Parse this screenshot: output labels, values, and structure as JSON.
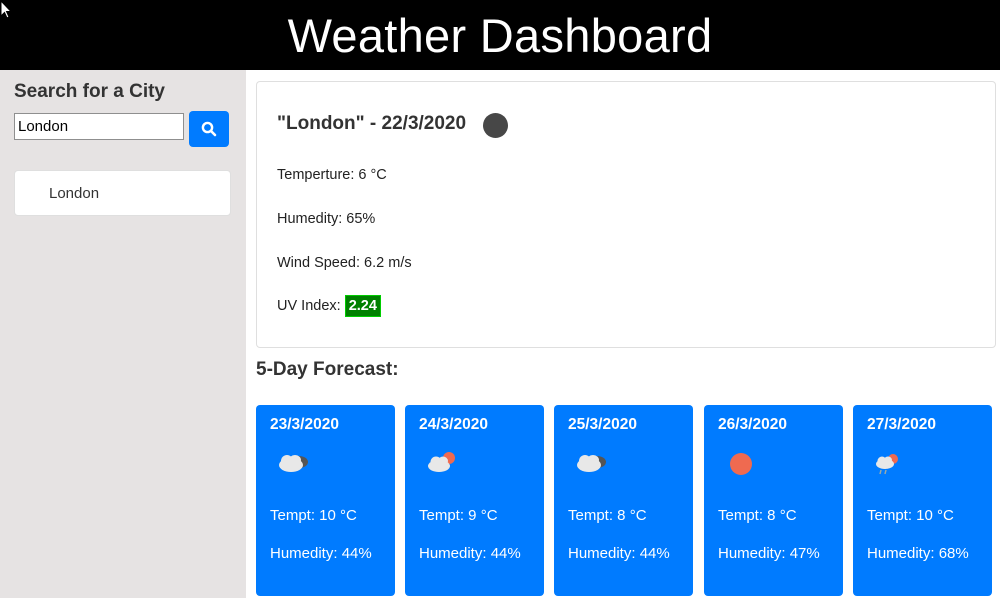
{
  "header": {
    "title": "Weather Dashboard"
  },
  "sidebar": {
    "heading": "Search for a City",
    "search": {
      "value": "London",
      "button_icon": "search-icon"
    },
    "history": [
      "London"
    ]
  },
  "current": {
    "title": "\"London\" - 22/3/2020",
    "icon": "dark-circle-icon",
    "temperature": "Temperture: 6 °C",
    "humidity": "Humedity: 65%",
    "wind": "Wind Speed: 6.2 m/s",
    "uv_label": "UV Index:",
    "uv_value": "2.24",
    "uv_color": "#008000"
  },
  "forecast": {
    "heading": "5-Day Forecast:",
    "days": [
      {
        "date": "23/3/2020",
        "icon": "cloud-icon",
        "temp": "Tempt: 10 °C",
        "humidity": "Humedity: 44%"
      },
      {
        "date": "24/3/2020",
        "icon": "sun-behind-cloud-icon",
        "temp": "Tempt: 9 °C",
        "humidity": "Humedity: 44%"
      },
      {
        "date": "25/3/2020",
        "icon": "cloud-icon",
        "temp": "Tempt: 8 °C",
        "humidity": "Humedity: 44%"
      },
      {
        "date": "26/3/2020",
        "icon": "sun-icon",
        "temp": "Tempt: 8 °C",
        "humidity": "Humedity: 47%"
      },
      {
        "date": "27/3/2020",
        "icon": "sun-rain-cloud-icon",
        "temp": "Tempt: 10 °C",
        "humidity": "Humedity: 68%"
      }
    ]
  },
  "colors": {
    "accent": "#007bff",
    "header_bg": "#000000",
    "sidebar_bg": "#e6e3e3"
  }
}
